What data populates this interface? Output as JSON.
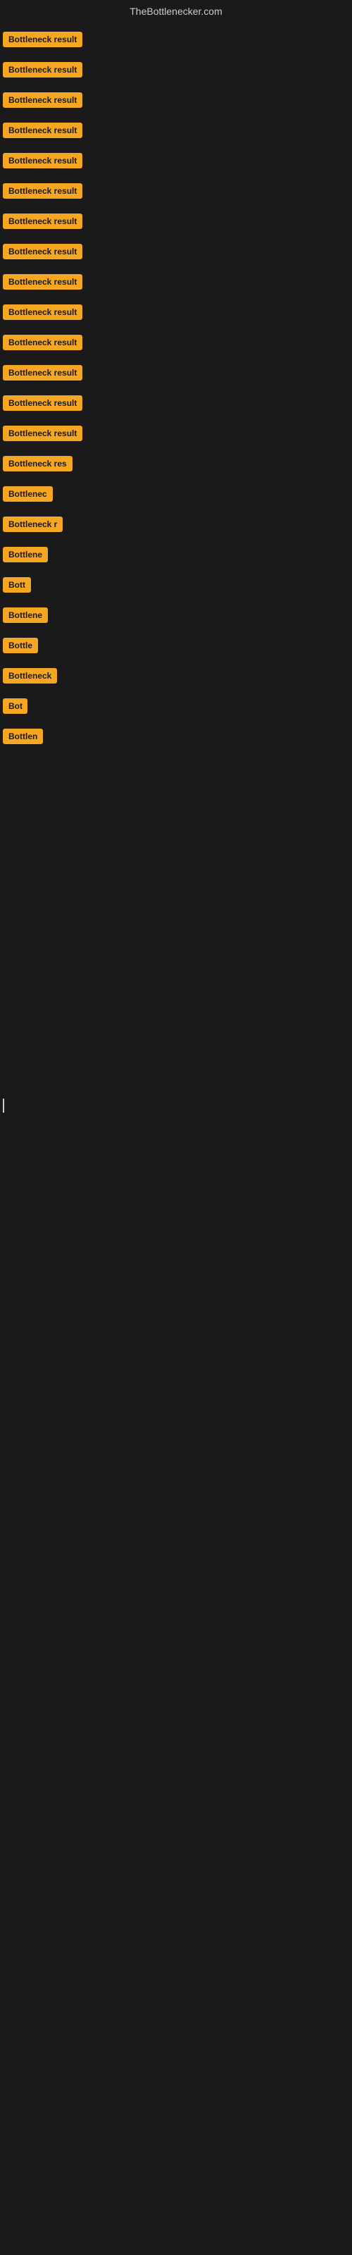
{
  "header": {
    "title": "TheBottlenecker.com"
  },
  "items": [
    {
      "label": "Bottleneck result",
      "width": "full"
    },
    {
      "label": "Bottleneck result",
      "width": "full"
    },
    {
      "label": "Bottleneck result",
      "width": "full"
    },
    {
      "label": "Bottleneck result",
      "width": "full"
    },
    {
      "label": "Bottleneck result",
      "width": "full"
    },
    {
      "label": "Bottleneck result",
      "width": "full"
    },
    {
      "label": "Bottleneck result",
      "width": "full"
    },
    {
      "label": "Bottleneck result",
      "width": "full"
    },
    {
      "label": "Bottleneck result",
      "width": "full"
    },
    {
      "label": "Bottleneck result",
      "width": "full"
    },
    {
      "label": "Bottleneck result",
      "width": "full"
    },
    {
      "label": "Bottleneck result",
      "width": "full"
    },
    {
      "label": "Bottleneck result",
      "width": "full"
    },
    {
      "label": "Bottleneck result",
      "width": "full"
    },
    {
      "label": "Bottleneck res",
      "width": "partial1"
    },
    {
      "label": "Bottlenec",
      "width": "partial2"
    },
    {
      "label": "Bottleneck r",
      "width": "partial3"
    },
    {
      "label": "Bottlene",
      "width": "partial4"
    },
    {
      "label": "Bott",
      "width": "partial5"
    },
    {
      "label": "Bottlene",
      "width": "partial4"
    },
    {
      "label": "Bottle",
      "width": "partial6"
    },
    {
      "label": "Bottleneck",
      "width": "partial7"
    },
    {
      "label": "Bot",
      "width": "partial8"
    },
    {
      "label": "Bottlen",
      "width": "partial9"
    }
  ],
  "colors": {
    "badge_bg": "#f5a623",
    "badge_text": "#1a1a1a",
    "page_bg": "#1a1a1a",
    "title_color": "#cccccc"
  }
}
